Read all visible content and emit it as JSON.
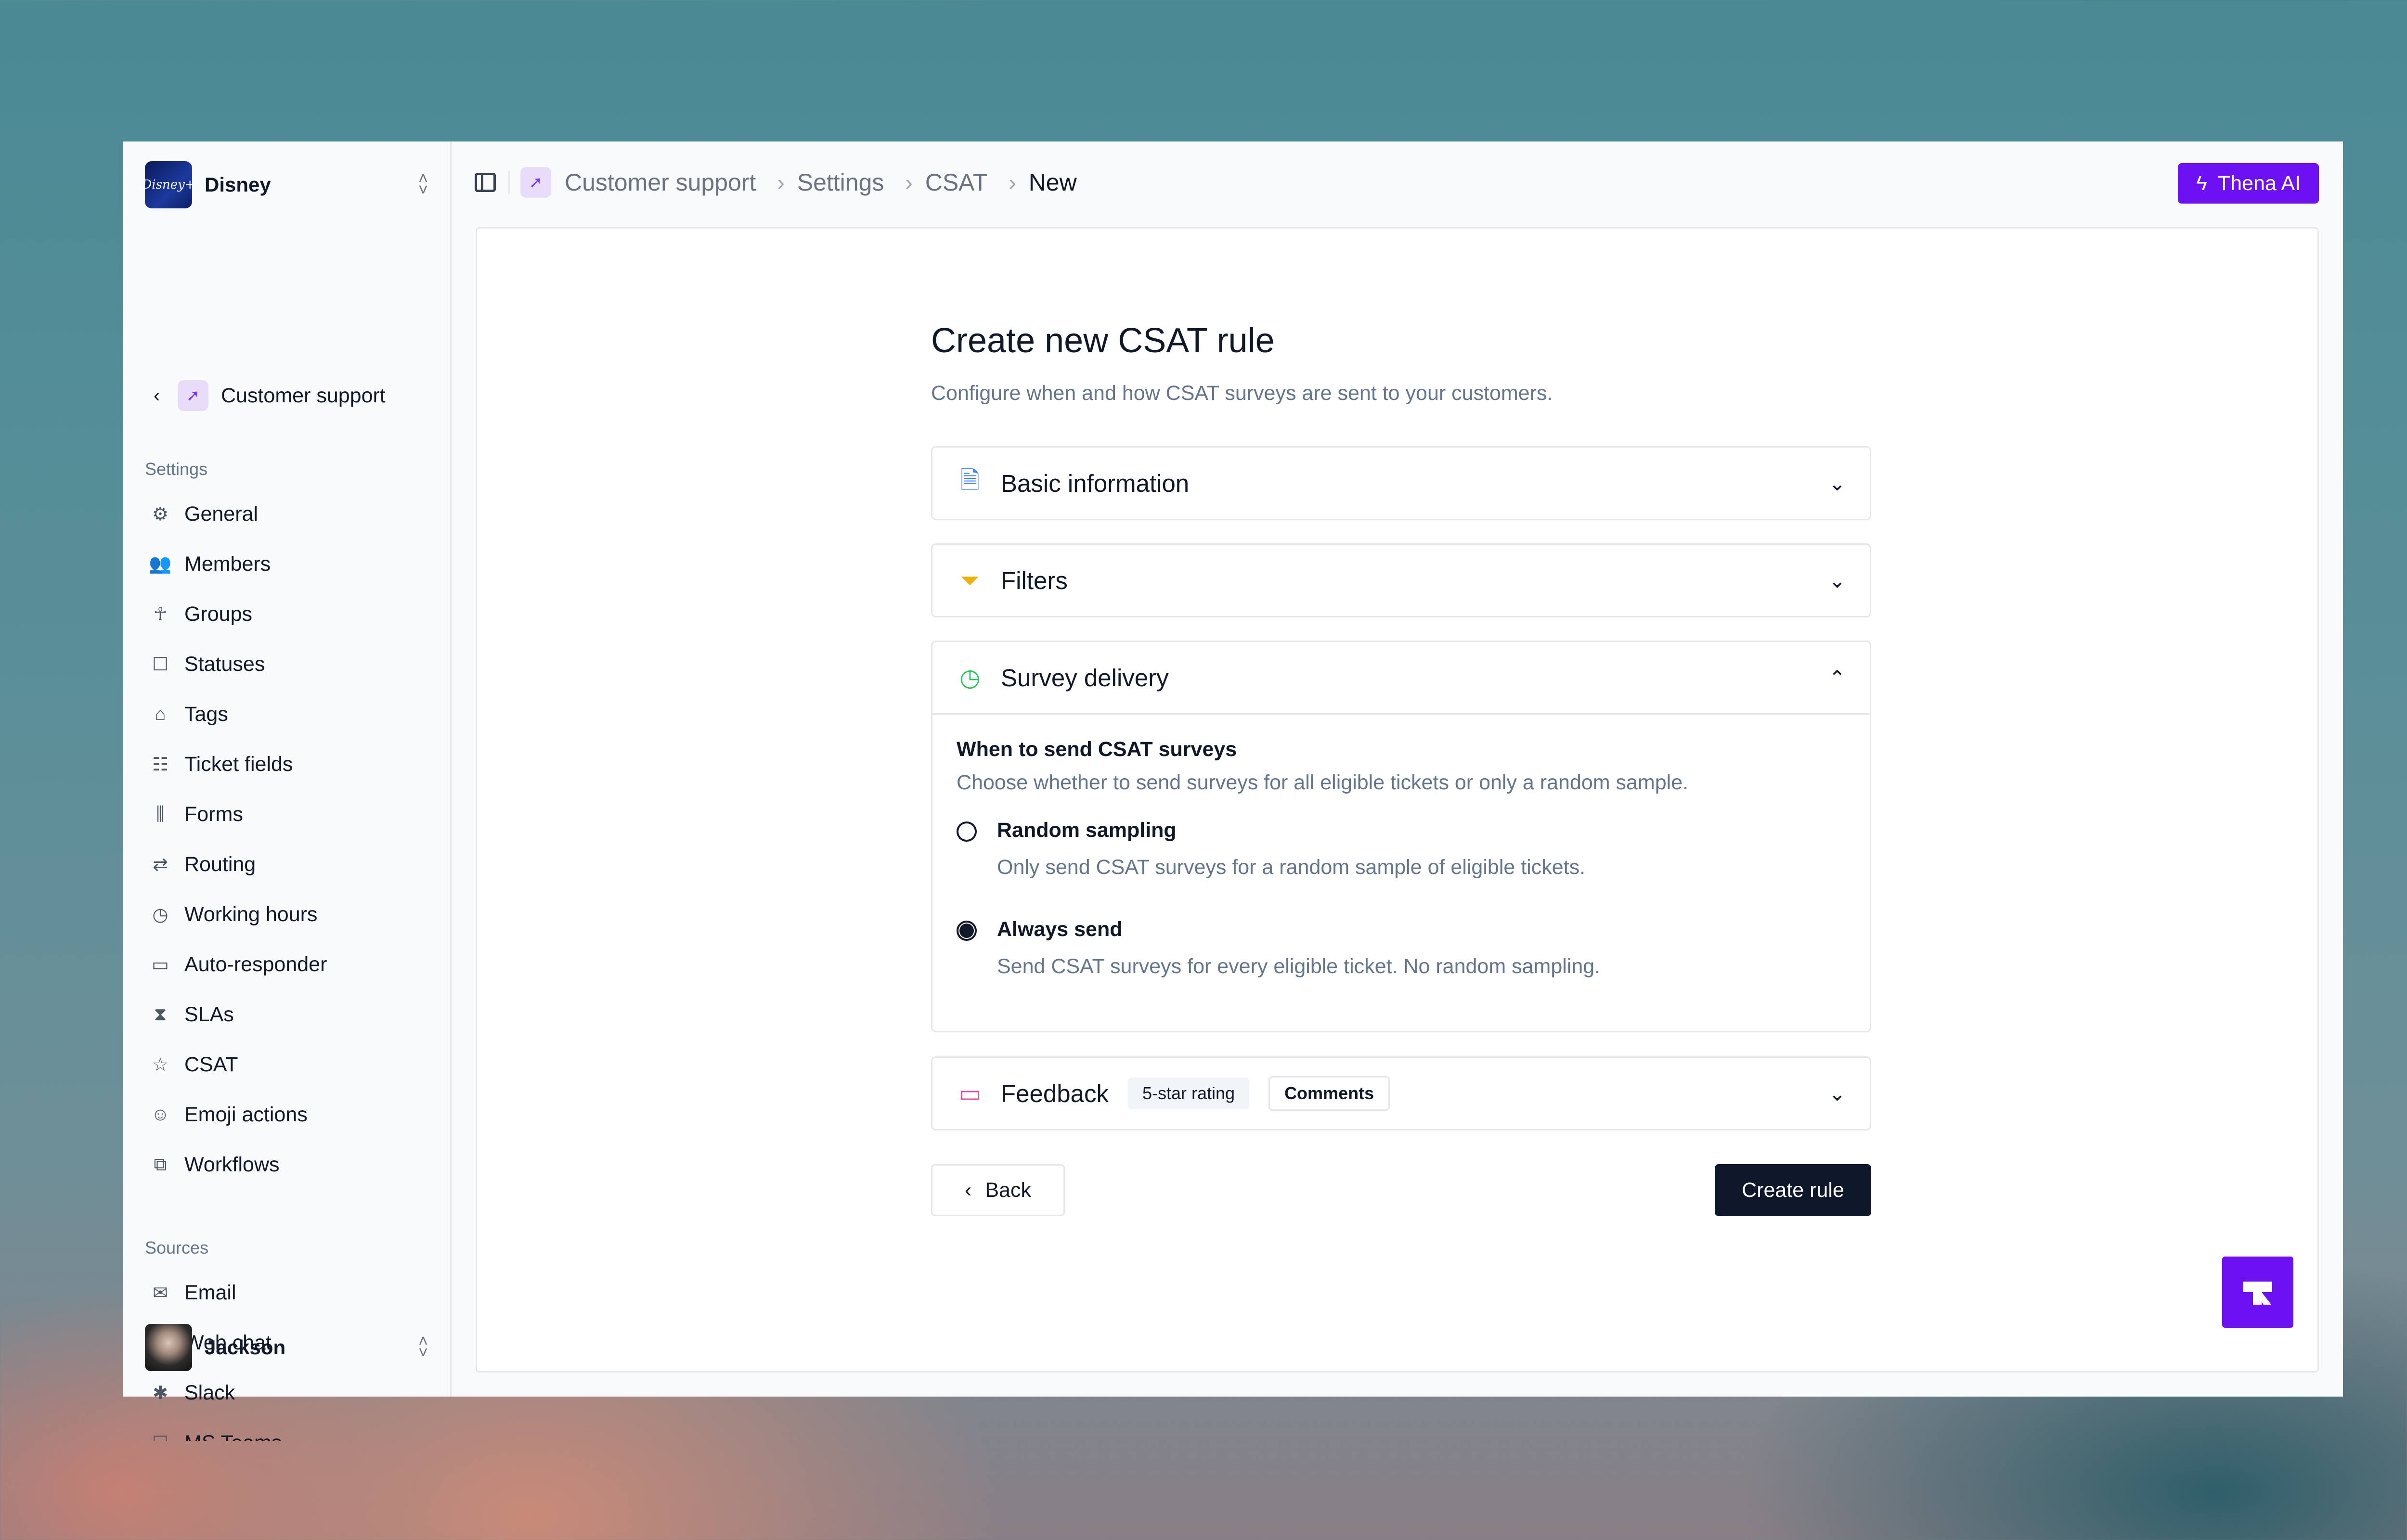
{
  "workspace": {
    "name": "Disney",
    "logo_text": "Disney+"
  },
  "team": {
    "name": "Customer support"
  },
  "sidebar": {
    "settings_label": "Settings",
    "items": [
      {
        "label": "General",
        "icon": "gear-icon"
      },
      {
        "label": "Members",
        "icon": "users-icon"
      },
      {
        "label": "Groups",
        "icon": "person-icon"
      },
      {
        "label": "Statuses",
        "icon": "square-icon"
      },
      {
        "label": "Tags",
        "icon": "tag-icon"
      },
      {
        "label": "Ticket fields",
        "icon": "list-icon"
      },
      {
        "label": "Forms",
        "icon": "library-icon"
      },
      {
        "label": "Routing",
        "icon": "route-icon"
      },
      {
        "label": "Working hours",
        "icon": "clock-icon"
      },
      {
        "label": "Auto-responder",
        "icon": "message-icon"
      },
      {
        "label": "SLAs",
        "icon": "hourglass-icon"
      },
      {
        "label": "CSAT",
        "icon": "star-icon"
      },
      {
        "label": "Emoji actions",
        "icon": "smile-icon"
      },
      {
        "label": "Workflows",
        "icon": "workflow-icon"
      }
    ],
    "sources_label": "Sources",
    "sources": [
      {
        "label": "Email",
        "icon": "mail-icon"
      },
      {
        "label": "Web chat",
        "icon": "chat-icon"
      },
      {
        "label": "Slack",
        "icon": "slack-icon"
      },
      {
        "label": "MS Teams",
        "icon": "teams-icon"
      }
    ]
  },
  "user": {
    "name": "Jackson"
  },
  "breadcrumb": [
    "Customer support",
    "Settings",
    "CSAT",
    "New"
  ],
  "ai_button": {
    "label": "Thena AI"
  },
  "form": {
    "title": "Create new CSAT rule",
    "subtitle": "Configure when and how CSAT surveys are sent to your customers.",
    "sections": {
      "basic": {
        "title": "Basic information",
        "color": "#3b82f6"
      },
      "filters": {
        "title": "Filters",
        "color": "#eab308"
      },
      "delivery": {
        "title": "Survey delivery",
        "color": "#22c55e",
        "question": "When to send CSAT surveys",
        "question_sub": "Choose whether to send surveys for all eligible tickets or only a random sample.",
        "options": [
          {
            "label": "Random sampling",
            "desc": "Only send CSAT surveys for a random sample of eligible tickets.",
            "selected": false
          },
          {
            "label": "Always send",
            "desc": "Send CSAT surveys for every eligible ticket. No random sampling.",
            "selected": true
          }
        ]
      },
      "feedback": {
        "title": "Feedback",
        "color": "#ec4899",
        "badges": [
          "5-star rating",
          "Comments"
        ]
      }
    },
    "back_label": "Back",
    "create_label": "Create rule"
  },
  "colors": {
    "accent": "#6d11f2",
    "primary_button": "#0f172a"
  }
}
